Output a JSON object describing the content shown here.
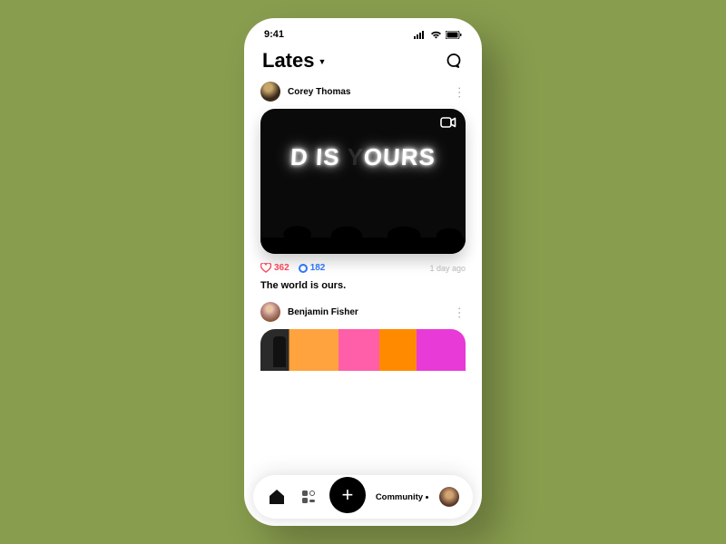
{
  "status": {
    "time": "9:41"
  },
  "header": {
    "title": "Lates"
  },
  "posts": [
    {
      "author": "Corey Thomas",
      "likes": "362",
      "comments": "182",
      "time": "1 day ago",
      "caption": "The world is ours.",
      "image_text_visible": "D IS",
      "image_text_dimmed": "Y",
      "image_text_rest": "OURS"
    },
    {
      "author": "Benjamin Fisher"
    }
  ],
  "tabbar": {
    "community": "Community",
    "add": "+"
  }
}
